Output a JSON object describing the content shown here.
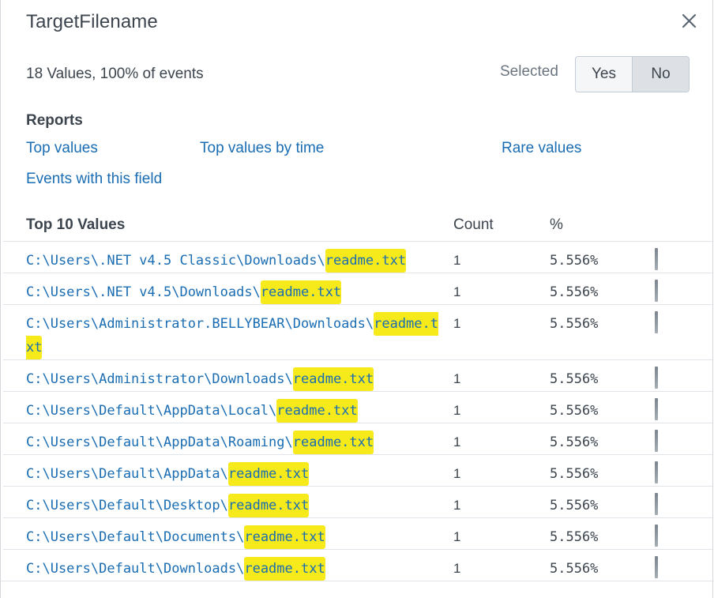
{
  "header": {
    "title": "TargetFilename",
    "close_icon": "close-icon"
  },
  "summary": {
    "text": "18 Values, 100% of events",
    "selected_label": "Selected",
    "yes_label": "Yes",
    "no_label": "No",
    "selected_value": "No"
  },
  "reports": {
    "heading": "Reports",
    "links": {
      "top_values": "Top values",
      "top_values_by_time": "Top values by time",
      "rare_values": "Rare values",
      "events_with_field": "Events with this field"
    }
  },
  "table": {
    "headers": {
      "value": "Top 10 Values",
      "count": "Count",
      "percent": "%"
    },
    "rows": [
      {
        "prefix": "C:\\Users\\.NET v4.5 Classic\\Downloads\\",
        "file": "readme.txt",
        "count": "1",
        "percent": "5.556%"
      },
      {
        "prefix": "C:\\Users\\.NET v4.5\\Downloads\\",
        "file": "readme.txt",
        "count": "1",
        "percent": "5.556%"
      },
      {
        "prefix": "C:\\Users\\Administrator.BELLYBEAR\\Downloads\\",
        "file": "readme.txt",
        "count": "1",
        "percent": "5.556%"
      },
      {
        "prefix": "C:\\Users\\Administrator\\Downloads\\",
        "file": "readme.txt",
        "count": "1",
        "percent": "5.556%"
      },
      {
        "prefix": "C:\\Users\\Default\\AppData\\Local\\",
        "file": "readme.txt",
        "count": "1",
        "percent": "5.556%"
      },
      {
        "prefix": "C:\\Users\\Default\\AppData\\Roaming\\",
        "file": "readme.txt",
        "count": "1",
        "percent": "5.556%"
      },
      {
        "prefix": "C:\\Users\\Default\\AppData\\",
        "file": "readme.txt",
        "count": "1",
        "percent": "5.556%"
      },
      {
        "prefix": "C:\\Users\\Default\\Desktop\\",
        "file": "readme.txt",
        "count": "1",
        "percent": "5.556%"
      },
      {
        "prefix": "C:\\Users\\Default\\Documents\\",
        "file": "readme.txt",
        "count": "1",
        "percent": "5.556%"
      },
      {
        "prefix": "C:\\Users\\Default\\Downloads\\",
        "file": "readme.txt",
        "count": "1",
        "percent": "5.556%"
      }
    ]
  },
  "colors": {
    "link": "#1a6db3",
    "highlight": "#f7ea1a",
    "text": "#3c444d"
  }
}
